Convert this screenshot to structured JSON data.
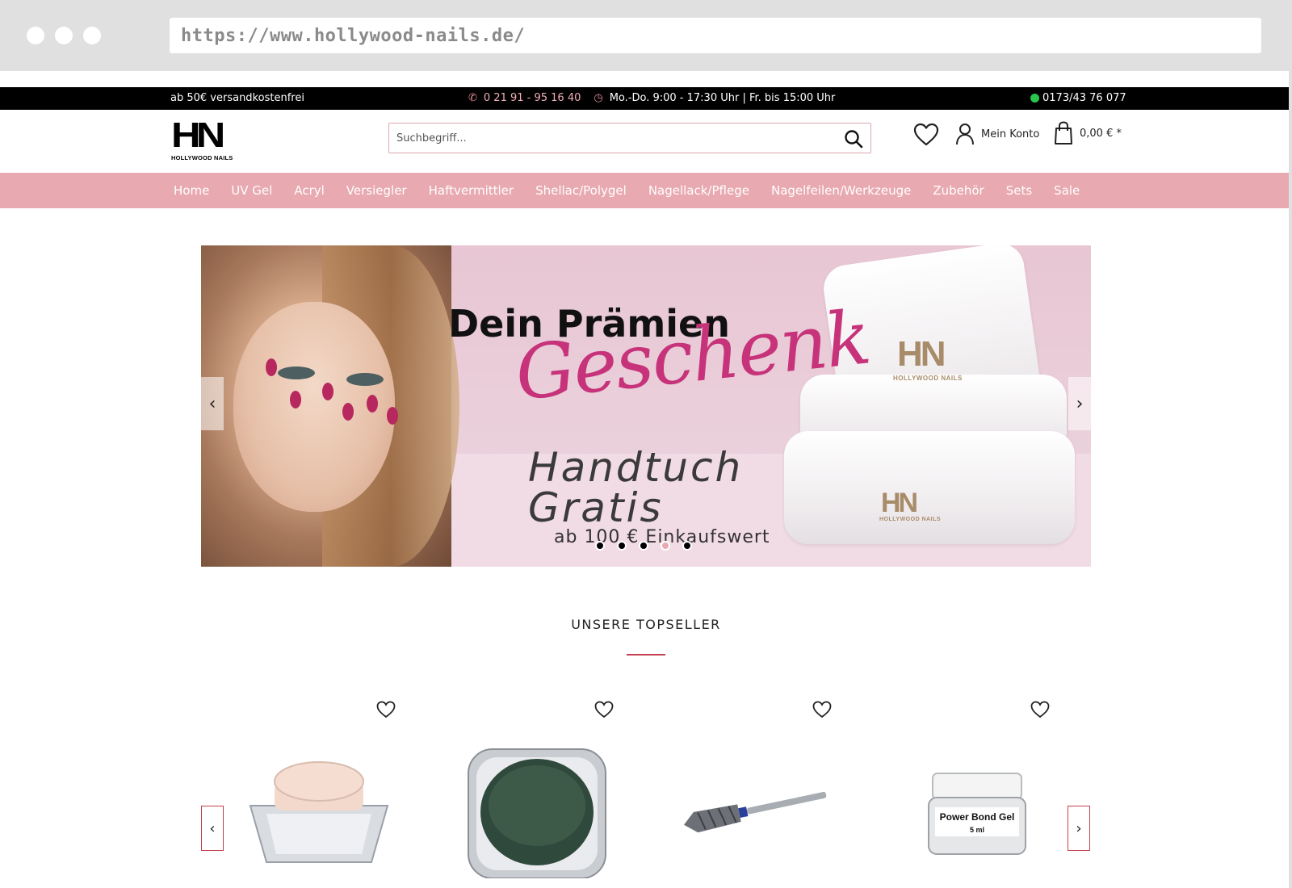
{
  "browser": {
    "url": "https://www.hollywood-nails.de/"
  },
  "topbar": {
    "shipping": "ab 50€ versandkostenfrei",
    "phone": "0 21 91 - 95 16 40",
    "hours": "Mo.-Do. 9:00 - 17:30 Uhr | Fr. bis 15:00 Uhr",
    "whatsapp": "0173/43 76 077"
  },
  "header": {
    "logo_mark": "HN",
    "logo_sub": "HOLLYWOOD NAILS",
    "search_placeholder": "Suchbegriff...",
    "account_label": "Mein Konto",
    "cart_total": "0,00 € *"
  },
  "nav": {
    "items": [
      "Home",
      "UV Gel",
      "Acryl",
      "Versiegler",
      "Haftvermittler",
      "Shellac/Polygel",
      "Nagellack/Pflege",
      "Nagelfeilen/Werkzeuge",
      "Zubehör",
      "Sets",
      "Sale"
    ]
  },
  "hero": {
    "line1": "Dein Prämien",
    "line2": "Geschenk",
    "line3a": "Handtuch",
    "line3b": "Gratis",
    "line4": "ab 100 € Einkaufswert",
    "towel_logo": "HN",
    "towel_logo_sub": "HOLLYWOOD NAILS",
    "prev": "‹",
    "next": "›",
    "slide_count": 5,
    "active_slide": 4
  },
  "topseller": {
    "title": "UNSERE TOPSELLER",
    "product_jar_label_1": "Power Bond Gel",
    "product_jar_label_2": "5 ml",
    "prev": "‹",
    "next": "›"
  },
  "colors": {
    "accent_pink": "#e8a9b0",
    "accent_red": "#c2404f",
    "headline_magenta": "#c7337a"
  }
}
